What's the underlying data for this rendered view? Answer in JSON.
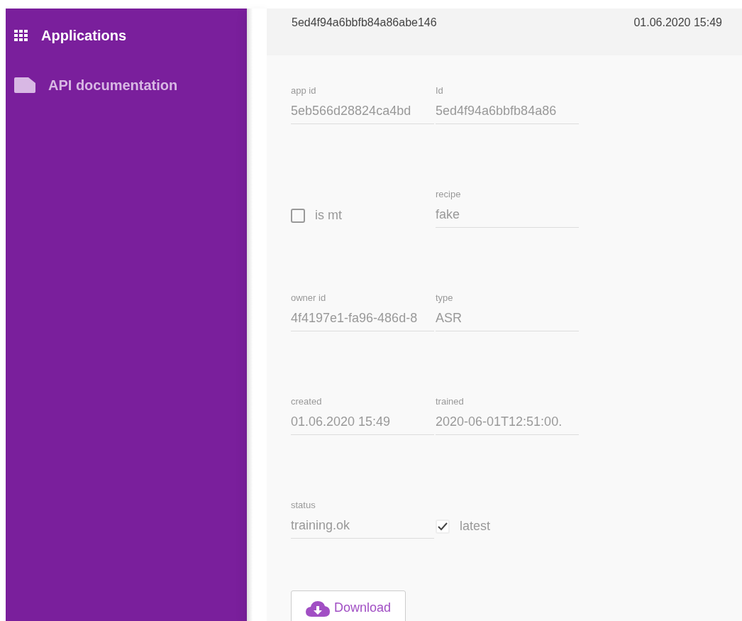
{
  "sidebar": {
    "items": [
      {
        "label": "Applications",
        "kind": "grid",
        "selected": true
      },
      {
        "label": "API documentation",
        "kind": "doc",
        "selected": false
      }
    ]
  },
  "header": {
    "id": "5ed4f94a6bbfb84a86abe146",
    "date": "01.06.2020 15:49"
  },
  "form": {
    "rows": [
      [
        {
          "kind": "text",
          "label": "app id",
          "value": "5eb566d28824ca4bd"
        },
        {
          "kind": "text",
          "label": "Id",
          "value": "5ed4f94a6bbfb84a86"
        }
      ],
      [
        {
          "kind": "checkbox",
          "label": "is mt",
          "checked": false
        },
        {
          "kind": "text",
          "label": "recipe",
          "value": "fake"
        }
      ],
      [
        {
          "kind": "text",
          "label": "owner id",
          "value": "4f4197e1-fa96-486d-8"
        },
        {
          "kind": "text",
          "label": "type",
          "value": "ASR"
        }
      ],
      [
        {
          "kind": "text",
          "label": "created",
          "value": "01.06.2020 15:49"
        },
        {
          "kind": "text",
          "label": "trained",
          "value": "2020-06-01T12:51:00."
        }
      ],
      [
        {
          "kind": "text",
          "label": "status",
          "value": "training.ok"
        },
        {
          "kind": "checkbox",
          "label": "latest",
          "checked": true
        }
      ]
    ]
  },
  "download_button": {
    "label": "Download"
  }
}
